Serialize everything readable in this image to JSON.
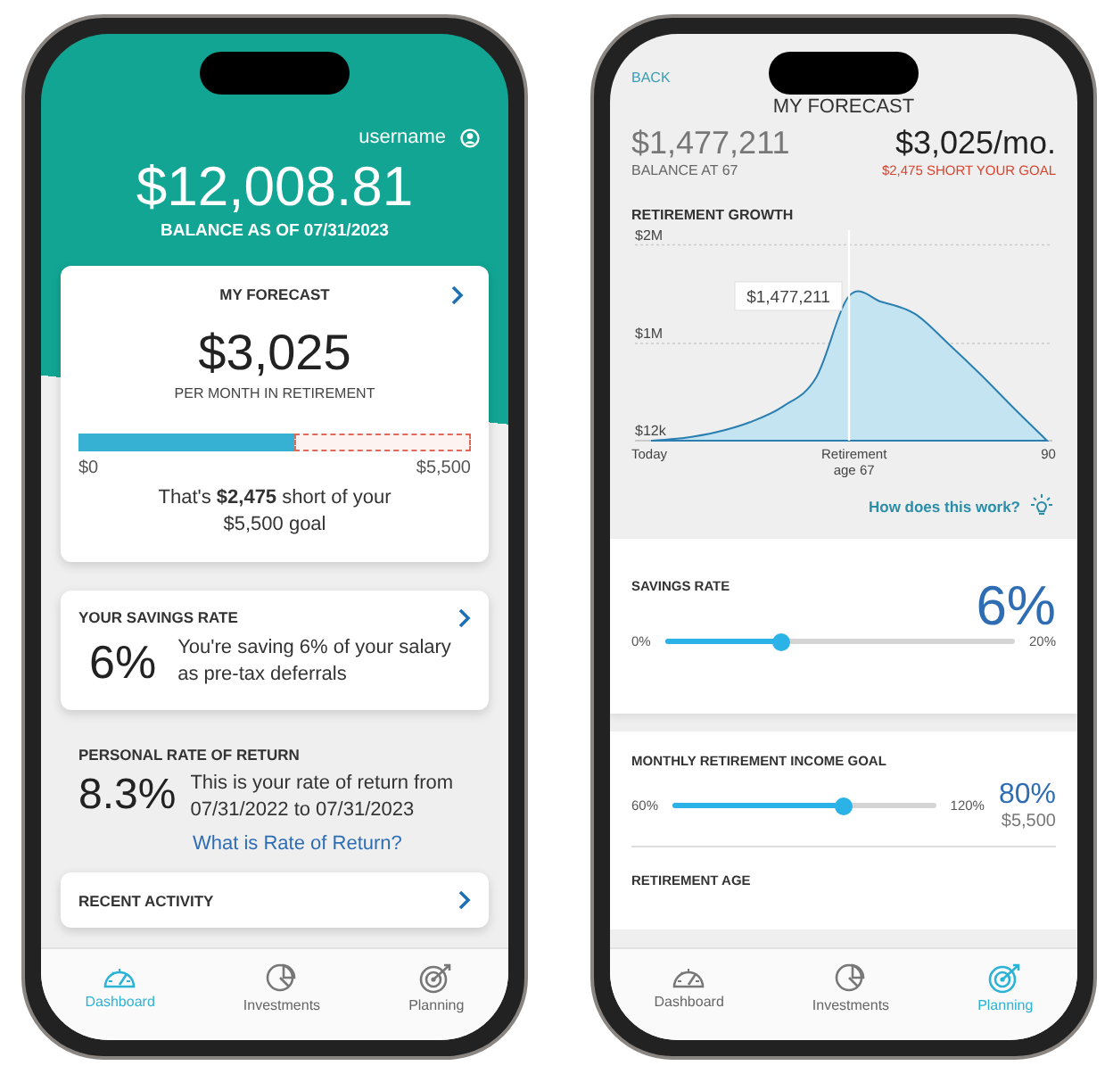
{
  "dashboard_screen": {
    "username": "username",
    "balance": "$12,008.81",
    "balance_caption": "BALANCE AS OF 07/31/2023",
    "forecast_card": {
      "title": "MY FORECAST",
      "amount": "$3,025",
      "caption": "PER MONTH IN RETIREMENT",
      "progress": {
        "level": 0.55,
        "min_label": "$0",
        "max_label": "$5,500"
      },
      "note": "That's **$2,475** short of your $5,500 goal"
    },
    "savings_card": {
      "title": "YOUR SAVINGS RATE",
      "value": "6%",
      "text": "You're saving 6% of your salary as pre-tax deferrals"
    },
    "rate_of_return": {
      "title": "PERSONAL RATE OF RETURN",
      "value": "8.3%",
      "text": "This is your rate of return from 07/31/2022 to 07/31/2023",
      "link": "What is Rate of Return?"
    },
    "recent_activity": {
      "title": "RECENT ACTIVITY"
    },
    "tab_bar": [
      {
        "label": "Dashboard",
        "selected": true
      },
      {
        "label": "Investments",
        "selected": false
      },
      {
        "label": "Planning",
        "selected": false
      }
    ]
  },
  "forecast_screen": {
    "back": "BACK",
    "title": "MY FORECAST",
    "balance": "$1,477,211",
    "balance_caption": "BALANCE AT 67",
    "monthly": "$3,025/mo.",
    "shortfall": "$2,475 SHORT YOUR GOAL",
    "growth": {
      "title": "RETIREMENT GROWTH",
      "chart_data": {
        "type": "area",
        "categories": [
          "Today",
          null,
          null,
          null,
          null,
          null,
          "Retirement age 67",
          null,
          null,
          null,
          null,
          null,
          "90"
        ],
        "series": [
          {
            "color": "#2a7fb0",
            "values": [
              12000,
              40000,
              100000,
              200000,
              360000,
              650000,
              1480000,
              1420000,
              1300000,
              1000000,
              680000,
              340000,
              12000
            ]
          }
        ],
        "ylim": [
          12000,
          2150000
        ],
        "yticks": [
          {
            "value": 12000,
            "label": "$12k"
          },
          {
            "value": 1000000,
            "label": "$1M"
          },
          {
            "value": 2000000,
            "label": "$2M"
          }
        ],
        "annotations": [
          {
            "x": "Retirement age 67",
            "y": 1480000,
            "text": "$1,477,211"
          }
        ]
      },
      "help_link": "How does this work?"
    },
    "savings_rate": {
      "title": "SAVINGS RATE",
      "value": "6%",
      "min_label": "0%",
      "max_label": "20%",
      "level": 0.33
    },
    "income_goal": {
      "title": "MONTHLY RETIREMENT INCOME GOAL",
      "min_label": "60%",
      "max_label": "120%",
      "level": 0.65,
      "value": "80%",
      "amount": "$5,500"
    },
    "retirement_age": {
      "title": "RETIREMENT AGE"
    },
    "tab_bar": [
      {
        "label": "Dashboard",
        "selected": false
      },
      {
        "label": "Investments",
        "selected": false
      },
      {
        "label": "Planning",
        "selected": true
      }
    ]
  }
}
